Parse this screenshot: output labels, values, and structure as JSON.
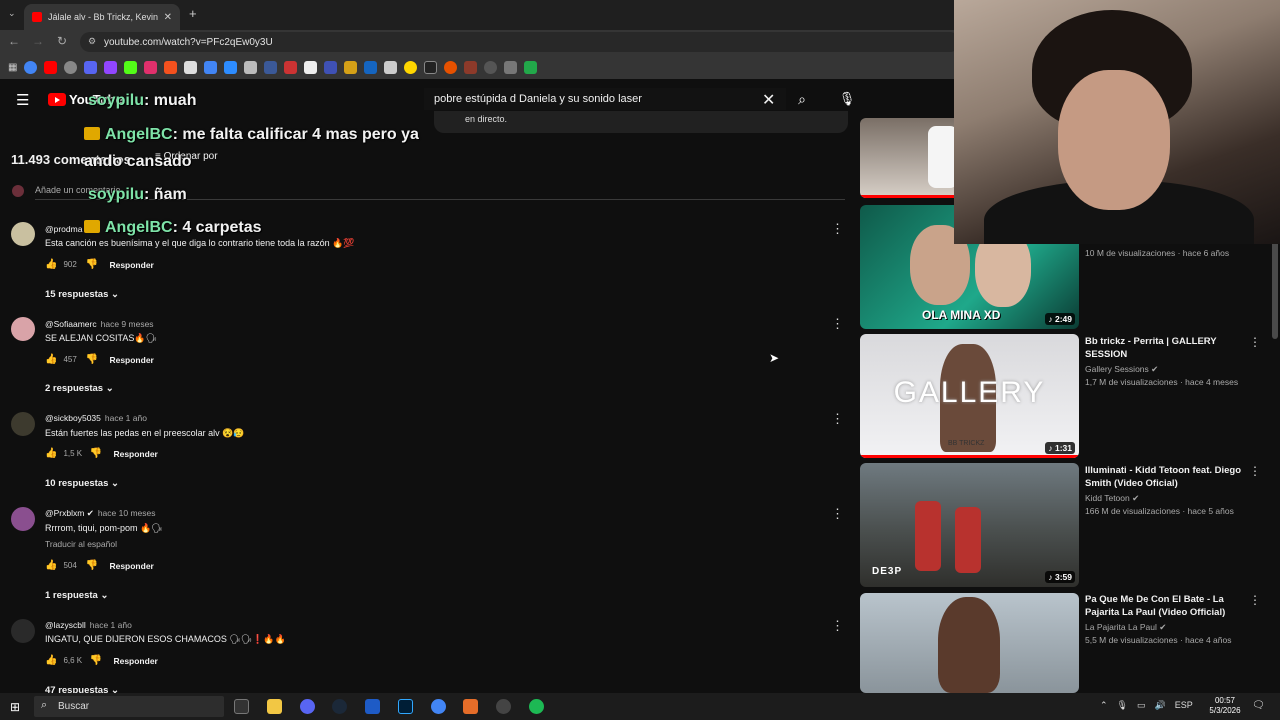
{
  "browser": {
    "tab_title": "Jálale alv - Bb Trickz, Kevin AMF",
    "url": "youtube.com/watch?v=PFc2qEw0y3U"
  },
  "youtube": {
    "logo": "YouTube",
    "search_value": "pobre estúpida d Daniela y su sonido laser",
    "suggestion": "en directo.",
    "comments_count": "11.493 comentarios",
    "sort_label": "Ordenar por",
    "add_comment_placeholder": "Añade un comentario...",
    "reply_label": "Responder"
  },
  "comments": [
    {
      "author": "@prodma",
      "time": "",
      "text": "Esta canción es buenísima y el que diga lo contrario tiene toda la razón 🔥💯",
      "likes": "902",
      "replies": "15 respuestas",
      "translate": ""
    },
    {
      "author": "@Sofiaamerc",
      "time": "hace 9 meses",
      "text": "SE ALEJAN COSITAS🔥🗣",
      "likes": "457",
      "replies": "2 respuestas",
      "translate": ""
    },
    {
      "author": "@sickboy5035",
      "time": "hace 1 año",
      "text": "Están fuertes las pedas en el preescolar alv 😵😥",
      "likes": "1,5 K",
      "replies": "10 respuestas",
      "translate": ""
    },
    {
      "author": "@Prxblxm",
      "time": "hace 10 meses",
      "text": "Rrrrom, tiqui, pom-pom 🔥🗣",
      "likes": "504",
      "replies": "1 respuesta",
      "translate": "Traducir al español"
    },
    {
      "author": "@lazyscbll",
      "time": "hace 1 año",
      "text": "INGATU, QUE DIJERON ESOS CHAMACOS 🗣🗣❗🔥🔥",
      "likes": "6,6 K",
      "replies": "47 respuestas",
      "translate": ""
    }
  ],
  "overlay_chat": [
    {
      "name": "soypilu",
      "msg": ": muah",
      "crown": false
    },
    {
      "name": "AngelBC",
      "msg": ": me falta calificar 4 mas pero ya",
      "crown": true
    },
    {
      "name": "",
      "msg": "ando cansado",
      "crown": false
    },
    {
      "name": "soypilu",
      "msg": ": ñam",
      "crown": false
    },
    {
      "name": "AngelBC",
      "msg": ": 4 carpetas",
      "crown": true
    }
  ],
  "sidebar": [
    {
      "title": "",
      "channel": "",
      "meta": "10 M de visualizaciones · hace 6 años",
      "duration": "2:49",
      "thumb_caption": "OLA MINA XD"
    },
    {
      "title": "Bb trickz - Perrita | GALLERY SESSION",
      "channel": "Gallery Sessions",
      "meta": "1,7 M de visualizaciones · hace 4 meses",
      "duration": "1:31",
      "thumb_caption": "GALLERY",
      "thumb_sub": "BB TRICKZ"
    },
    {
      "title": "Illuminati - Kidd Tetoon feat. Diego Smith (Video Oficial)",
      "channel": "Kidd Tetoon",
      "meta": "166 M de visualizaciones · hace 5 años",
      "duration": "3:59",
      "thumb_caption": "DE3P"
    },
    {
      "title": "Pa Que Me De Con El Bate - La Pajarita La Paul (Video Official)",
      "channel": "La Pajarita La Paul",
      "meta": "5,5 M de visualizaciones · hace 4 años",
      "duration": "",
      "thumb_caption": ""
    }
  ],
  "taskbar": {
    "search": "Buscar",
    "lang": "ESP",
    "time": "00:57",
    "date": "5/3/2026"
  },
  "colors": {
    "accent_red": "#ff0000",
    "chat_name": "#7ee3a8",
    "bg": "#0f0f0f"
  }
}
